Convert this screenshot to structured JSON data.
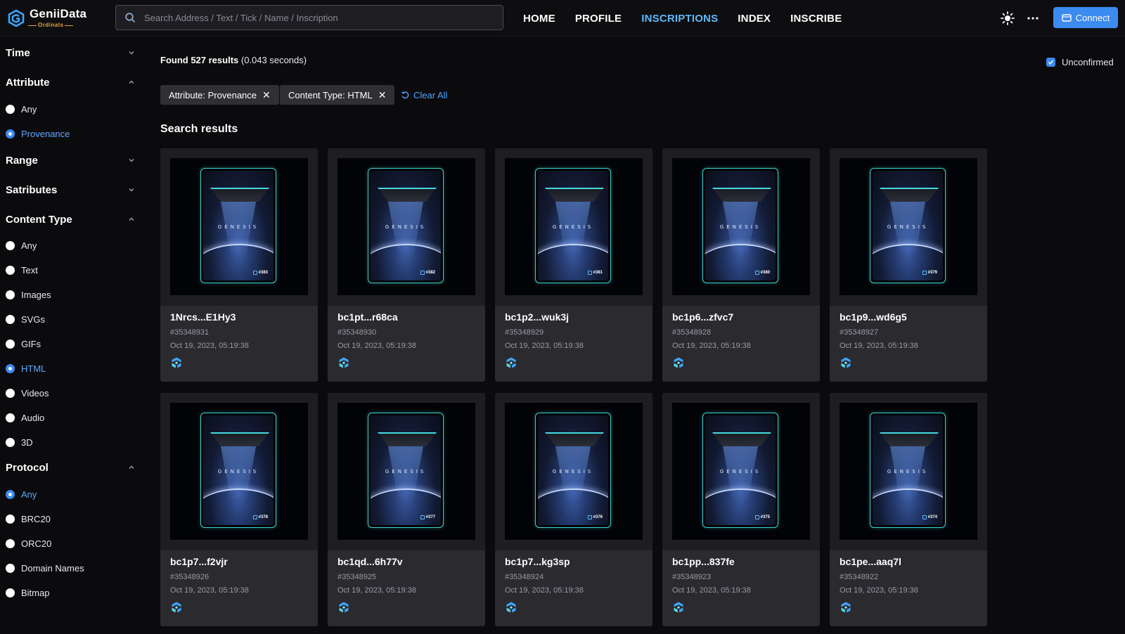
{
  "header": {
    "logo_name": "GeniiData",
    "logo_sub": "Ordinals",
    "search_placeholder": "Search Address / Text / Tick / Name / Inscription",
    "nav": [
      {
        "label": "HOME",
        "active": false
      },
      {
        "label": "PROFILE",
        "active": false
      },
      {
        "label": "INSCRIPTIONS",
        "active": true
      },
      {
        "label": "INDEX",
        "active": false
      },
      {
        "label": "INSCRIBE",
        "active": false
      }
    ],
    "connect_label": "Connect"
  },
  "sidebar": {
    "time": {
      "title": "Time"
    },
    "attribute": {
      "title": "Attribute",
      "options": [
        "Any",
        "Provenance"
      ],
      "selected": "Provenance"
    },
    "range": {
      "title": "Range"
    },
    "satributes": {
      "title": "Satributes"
    },
    "content_type": {
      "title": "Content Type",
      "options": [
        "Any",
        "Text",
        "Images",
        "SVGs",
        "GIFs",
        "HTML",
        "Videos",
        "Audio",
        "3D"
      ],
      "selected": "HTML"
    },
    "protocol": {
      "title": "Protocol",
      "options": [
        "Any",
        "BRC20",
        "ORC20",
        "Domain Names",
        "Bitmap"
      ],
      "selected": "Any"
    }
  },
  "main": {
    "found_count": "Found 527 results",
    "found_time": "(0.043 seconds)",
    "unconfirmed_label": "Unconfirmed",
    "filters": [
      "Attribute: Provenance",
      "Content Type: HTML"
    ],
    "clear_all": "Clear All",
    "results_title": "Search results",
    "genesis_text": "GENESIS",
    "cards": [
      {
        "name": "1Nrcs...E1Hy3",
        "number": "#35348931",
        "date": "Oct 19, 2023, 05:19:38",
        "badge": "#383"
      },
      {
        "name": "bc1pt...r68ca",
        "number": "#35348930",
        "date": "Oct 19, 2023, 05:19:38",
        "badge": "#382"
      },
      {
        "name": "bc1p2...wuk3j",
        "number": "#35348929",
        "date": "Oct 19, 2023, 05:19:38",
        "badge": "#381"
      },
      {
        "name": "bc1p6...zfvc7",
        "number": "#35348928",
        "date": "Oct 19, 2023, 05:19:38",
        "badge": "#380"
      },
      {
        "name": "bc1p9...wd6g5",
        "number": "#35348927",
        "date": "Oct 19, 2023, 05:19:38",
        "badge": "#379"
      },
      {
        "name": "bc1p7...f2vjr",
        "number": "#35348926",
        "date": "Oct 19, 2023, 05:19:38",
        "badge": "#378"
      },
      {
        "name": "bc1qd...6h77v",
        "number": "#35348925",
        "date": "Oct 19, 2023, 05:19:38",
        "badge": "#377"
      },
      {
        "name": "bc1p7...kg3sp",
        "number": "#35348924",
        "date": "Oct 19, 2023, 05:19:38",
        "badge": "#376"
      },
      {
        "name": "bc1pp...837fe",
        "number": "#35348923",
        "date": "Oct 19, 2023, 05:19:38",
        "badge": "#375"
      },
      {
        "name": "bc1pe...aaq7l",
        "number": "#35348922",
        "date": "Oct 19, 2023, 05:19:38",
        "badge": "#374"
      }
    ]
  },
  "colors": {
    "accent": "#3b8bf0",
    "nav_active": "#5fb8ff",
    "card_bg": "#2a2a2f",
    "page_bg": "#0b0b0d"
  }
}
